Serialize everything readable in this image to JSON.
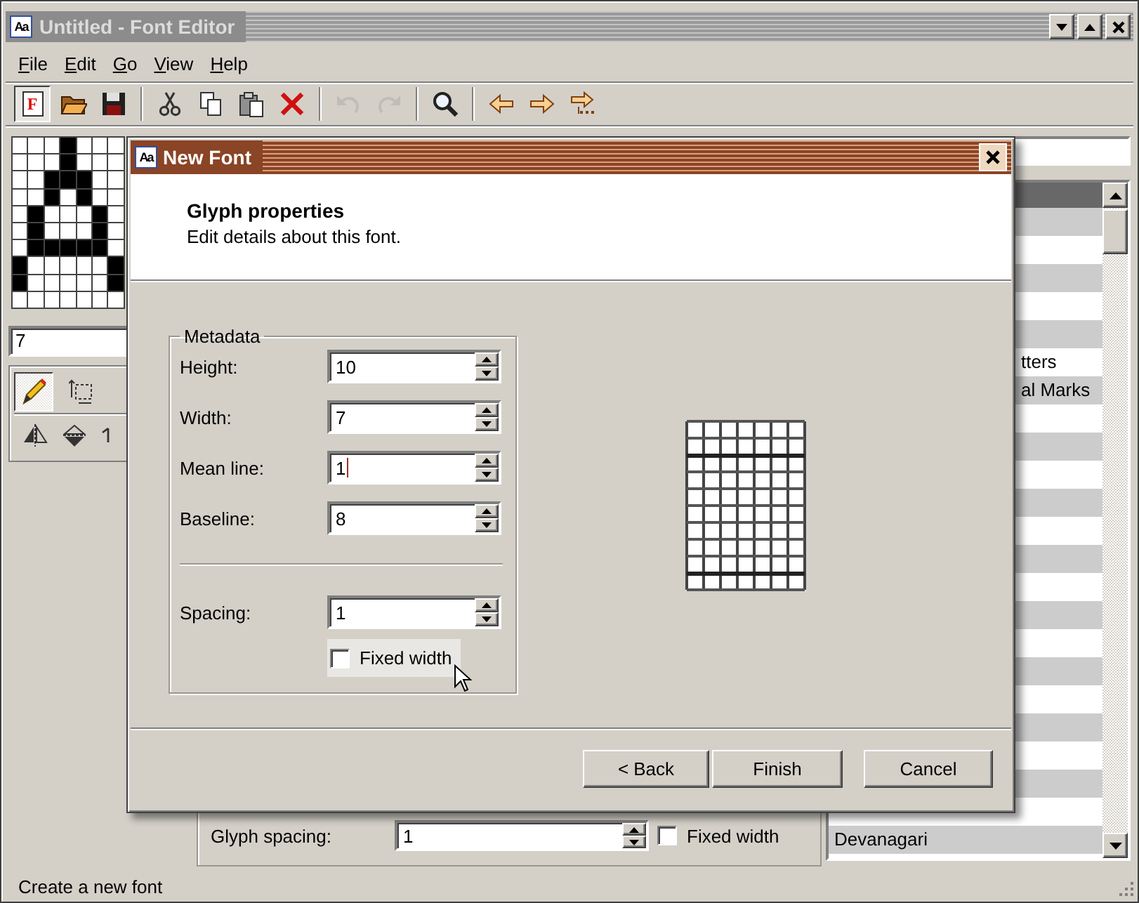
{
  "window": {
    "icon_text": "Aa",
    "title": "Untitled - Font Editor"
  },
  "menu": [
    "File",
    "Edit",
    "Go",
    "View",
    "Help"
  ],
  "toolbar": {
    "groups": [
      [
        {
          "glyph": "F",
          "pressed": true,
          "disabled": false
        },
        {
          "pressed": false,
          "disabled": false
        },
        {
          "pressed": false,
          "disabled": false
        }
      ],
      [
        {
          "pressed": false,
          "disabled": false
        },
        {
          "pressed": false,
          "disabled": false
        },
        {
          "pressed": false,
          "disabled": false
        },
        {
          "pressed": false,
          "disabled": false
        }
      ],
      [
        {
          "pressed": false,
          "disabled": true
        },
        {
          "pressed": false,
          "disabled": true
        }
      ],
      [
        {
          "pressed": false,
          "disabled": false
        }
      ],
      [
        {
          "pressed": false,
          "disabled": false
        },
        {
          "pressed": false,
          "disabled": false
        },
        {
          "pressed": false,
          "disabled": false
        }
      ]
    ]
  },
  "glyph_grid": {
    "rows": [
      [
        false,
        false,
        false,
        true,
        false,
        false,
        false
      ],
      [
        false,
        false,
        false,
        true,
        false,
        false,
        false
      ],
      [
        false,
        false,
        true,
        true,
        true,
        false,
        false
      ],
      [
        false,
        false,
        true,
        false,
        true,
        false,
        false
      ],
      [
        false,
        true,
        false,
        false,
        false,
        true,
        false
      ],
      [
        false,
        true,
        false,
        false,
        false,
        true,
        false
      ],
      [
        false,
        true,
        true,
        true,
        true,
        true,
        false
      ],
      [
        true,
        false,
        false,
        false,
        false,
        false,
        true
      ],
      [
        true,
        false,
        false,
        false,
        false,
        false,
        true
      ],
      [
        false,
        false,
        false,
        false,
        false,
        false,
        false
      ]
    ]
  },
  "glyph_field": {
    "value": "7"
  },
  "tools": [
    {
      "selected": true
    },
    {
      "selected": false
    }
  ],
  "glyph_spacing": {
    "label": "Glyph spacing:",
    "value": "1",
    "fixed_width": {
      "label": "Fixed width",
      "checked": false
    }
  },
  "font_list": {
    "rows": [
      {
        "selected": false
      },
      {
        "selected": false
      },
      {
        "selected": false
      },
      {
        "selected": false
      },
      {
        "selected": false
      },
      {
        "selected": false,
        "kind": "covered",
        "label": "tters"
      },
      {
        "selected": false,
        "kind": "covered",
        "label": "al Marks"
      },
      {
        "selected": false
      },
      {
        "selected": false
      },
      {
        "selected": false
      },
      {
        "selected": false
      },
      {
        "selected": false
      },
      {
        "selected": false
      },
      {
        "selected": false
      },
      {
        "selected": false
      },
      {
        "selected": false
      },
      {
        "selected": false
      },
      {
        "selected": false
      },
      {
        "selected": false
      },
      {
        "selected": false
      },
      {
        "selected": false
      },
      {
        "selected": false
      },
      {
        "selected": false,
        "kind": "plain",
        "label": "Devanagari"
      },
      {
        "selected": false
      }
    ]
  },
  "status_bar": "Create a new font",
  "dialog": {
    "icon_text": "Aa",
    "title": "New Font",
    "heading": "Glyph properties",
    "subheading": "Edit details about this font.",
    "metadata": {
      "title": "Metadata",
      "fields": [
        {
          "label": "Height:",
          "value": "10",
          "focused": false
        },
        {
          "label": "Width:",
          "value": "7",
          "focused": false
        },
        {
          "label": "Mean line:",
          "value": "1",
          "focused": true
        },
        {
          "label": "Baseline:",
          "value": "8",
          "focused": false
        }
      ],
      "spacing": {
        "label": "Spacing:",
        "value": "1",
        "focused": false
      },
      "fixed_width": {
        "label": "Fixed width",
        "checked": false,
        "hovered": true
      }
    },
    "buttons": [
      "< Back",
      "Finish",
      "Cancel"
    ]
  }
}
